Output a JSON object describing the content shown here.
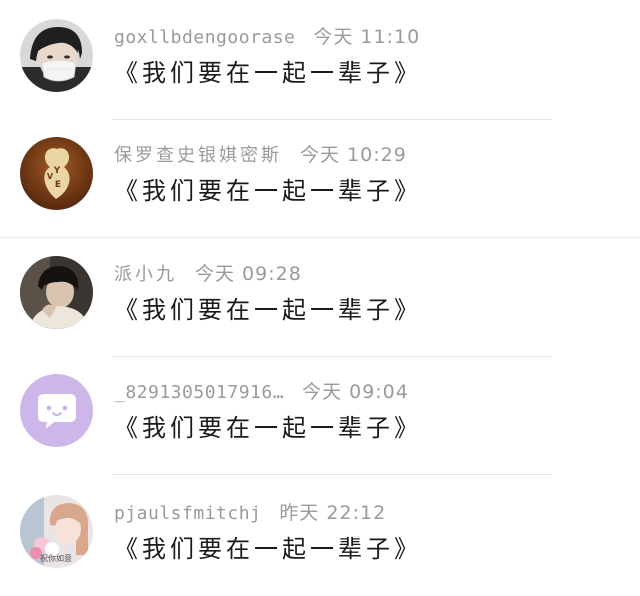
{
  "conversations": [
    {
      "avatar_icon": "avatar-person-mask",
      "name": "goxllbdengoorase",
      "time": "今天 11:10",
      "message": "《我们要在一起一辈子》"
    },
    {
      "avatar_icon": "avatar-love-heart",
      "name": "保罗查史银娸密斯",
      "time": "今天 10:29",
      "message": "《我们要在一起一辈子》"
    },
    {
      "avatar_icon": "avatar-person-photo",
      "name": "派小九",
      "time": "今天 09:28",
      "message": "《我们要在一起一辈子》"
    },
    {
      "avatar_icon": "avatar-chat-bubble",
      "name": "_8291305017916…",
      "time": "今天 09:04",
      "message": "《我们要在一起一辈子》"
    },
    {
      "avatar_icon": "avatar-girl-flowers",
      "avatar_text": "祝你如意",
      "name": "pjaulsfmitchj",
      "time": "昨天 22:12",
      "message": "《我们要在一起一辈子》"
    }
  ],
  "colors": {
    "name_time": "#9a9a9a",
    "message": "#1a1a1a",
    "divider": "#e4e4e4",
    "chat_bubble_bg": "#cdb6ea"
  }
}
